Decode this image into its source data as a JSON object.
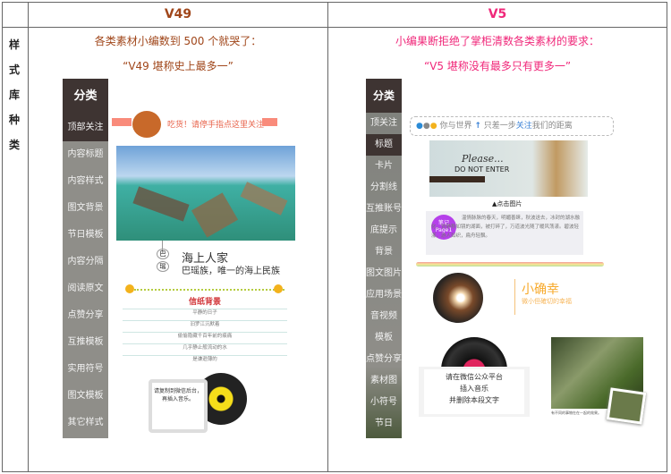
{
  "table": {
    "row_label": "样式库种类",
    "columns": [
      {
        "title": "V49",
        "intro_line1": "各类素材小编数到 500 个就哭了：",
        "intro_line2": "“V49 堪称史上最多一”",
        "color": "#a0461a"
      },
      {
        "title": "V5",
        "intro_line1": "小编果断拒绝了掌柜清数各类素材的要求：",
        "intro_line2": "“V5 堪称没有最多只有更多一”",
        "color": "#f0287a"
      }
    ]
  },
  "v49": {
    "sidebar": {
      "header": "分类",
      "items": [
        "顶部关注",
        "内容标题",
        "内容样式",
        "图文背景",
        "节日模板",
        "内容分隔",
        "阅读原文",
        "点赞分享",
        "互推模板",
        "实用符号",
        "图文模板",
        "其它样式"
      ],
      "active": 0
    },
    "banner": "吃货！请停手指点这里关注",
    "caption": {
      "badge1": "巴",
      "badge2": "瑶",
      "title": "海上人家",
      "subtitle": "巴瑶族，唯一的海上民族"
    },
    "letter": {
      "title": "信纸背景",
      "lines": [
        "平静的日子",
        "汨罗江沉默着",
        "偷偷隐藏千百年前的痕痛",
        "几乎静止般流动的水",
        "是谦逊薄的"
      ]
    },
    "music_card": "请复制到微信后台，再插入音乐。"
  },
  "v5": {
    "sidebar": {
      "header": "分类",
      "items": [
        "顶关注",
        "标题",
        "卡片",
        "分割线",
        "互推账号",
        "底提示",
        "背景",
        "图文图片",
        "应用场景",
        "音视频",
        "模板",
        "点赞分享",
        "素材图",
        "小符号",
        "节日"
      ],
      "active": 1
    },
    "follow_bar": {
      "left": "你与世界",
      "right_a": "只差一步",
      "highlight": "关注",
      "right_b": "我们的距离"
    },
    "photo_text": {
      "line1": "Please...",
      "line2": "DO NOT ENTER"
    },
    "photo_caption": "▲点击图片",
    "note": {
      "badge1": "笔记",
      "badge2": "Page1",
      "text": "温情脉脉的春天，明媚善睐，秋波送去，冰封的湖水融化，冒静穆如镜的湖面，被打碎了，万道波光随了暖风荡漾。碧波轻漾，游人如织，扁舟轻飘。"
    },
    "happiness": {
      "title": "小确幸",
      "subtitle": "微小但確切的幸福"
    },
    "music": {
      "lines": [
        "请在微信公众平台",
        "插入音乐",
        "并删除本段文字"
      ]
    },
    "forest_caption": "有不同的事物在在一起的效果。"
  }
}
